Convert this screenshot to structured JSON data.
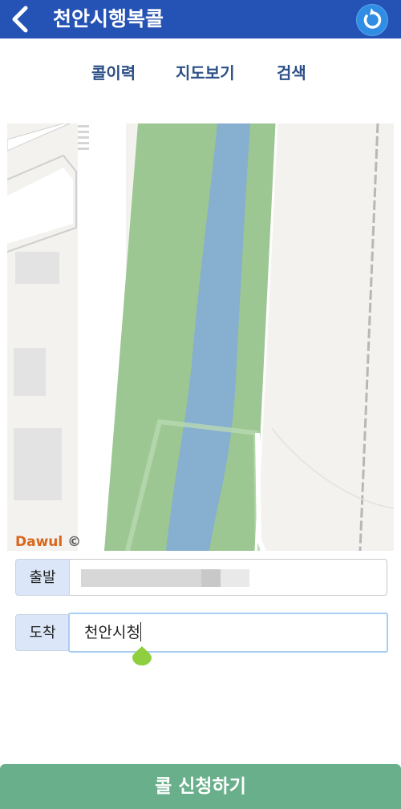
{
  "header": {
    "title": "천안시행복콜",
    "back_icon": "chevron-left-icon",
    "refresh_icon": "refresh-icon",
    "color": "#2553b5"
  },
  "tabs": [
    {
      "label": "콜이력"
    },
    {
      "label": "지도보기"
    },
    {
      "label": "검색"
    }
  ],
  "map": {
    "provider_logo": "Dawul",
    "copyright_symbol": "©"
  },
  "form": {
    "origin": {
      "label": "출발",
      "value": ""
    },
    "destination": {
      "label": "도착",
      "value": "천안시청"
    }
  },
  "submit": {
    "label": "콜 신청하기",
    "color": "#6aaf8b"
  }
}
